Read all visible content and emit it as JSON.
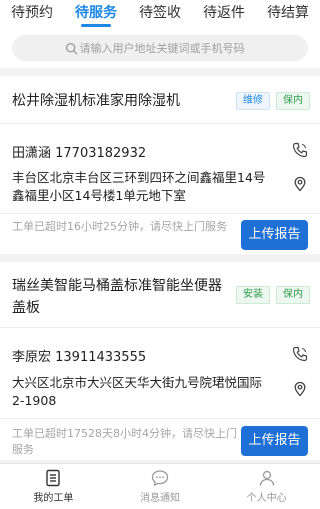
{
  "tabs": [
    {
      "label": "待预约",
      "active": false
    },
    {
      "label": "待服务",
      "active": true
    },
    {
      "label": "待签收",
      "active": false
    },
    {
      "label": "待返件",
      "active": false
    },
    {
      "label": "待结算",
      "active": false
    }
  ],
  "search": {
    "placeholder": "请输入用户地址关键词或手机号码"
  },
  "orders": [
    {
      "title": "松井除湿机标准家用除湿机",
      "service_type": "维修",
      "warranty": "保内",
      "contact": "田潇涵  17703182932",
      "address": "丰台区北京丰台区三环到四环之间鑫福里14号鑫福里小区14号楼1单元地下室",
      "notice": "工单已超时16小时25分钟，请尽快上门服务",
      "action": "上传报告"
    },
    {
      "title": "瑞丝美智能马桶盖标准智能坐便器盖板",
      "service_type": "安装",
      "warranty": "保内",
      "contact": "李原宏  13911433555",
      "address": "大兴区北京市大兴区天华大街九号院珺悦国际2-1908",
      "notice": "工单已超时17528天8小时4分钟，请尽快上门服务",
      "action": "上传报告"
    }
  ],
  "bottom_nav": [
    {
      "label": "我的工单",
      "icon": "work-order-icon",
      "active": true
    },
    {
      "label": "消息通知",
      "icon": "message-icon",
      "active": false
    },
    {
      "label": "个人中心",
      "icon": "user-icon",
      "active": false
    }
  ],
  "colors": {
    "accent": "#1e88e5",
    "button": "#1e6fd6",
    "warranty": "#2e9b48"
  }
}
